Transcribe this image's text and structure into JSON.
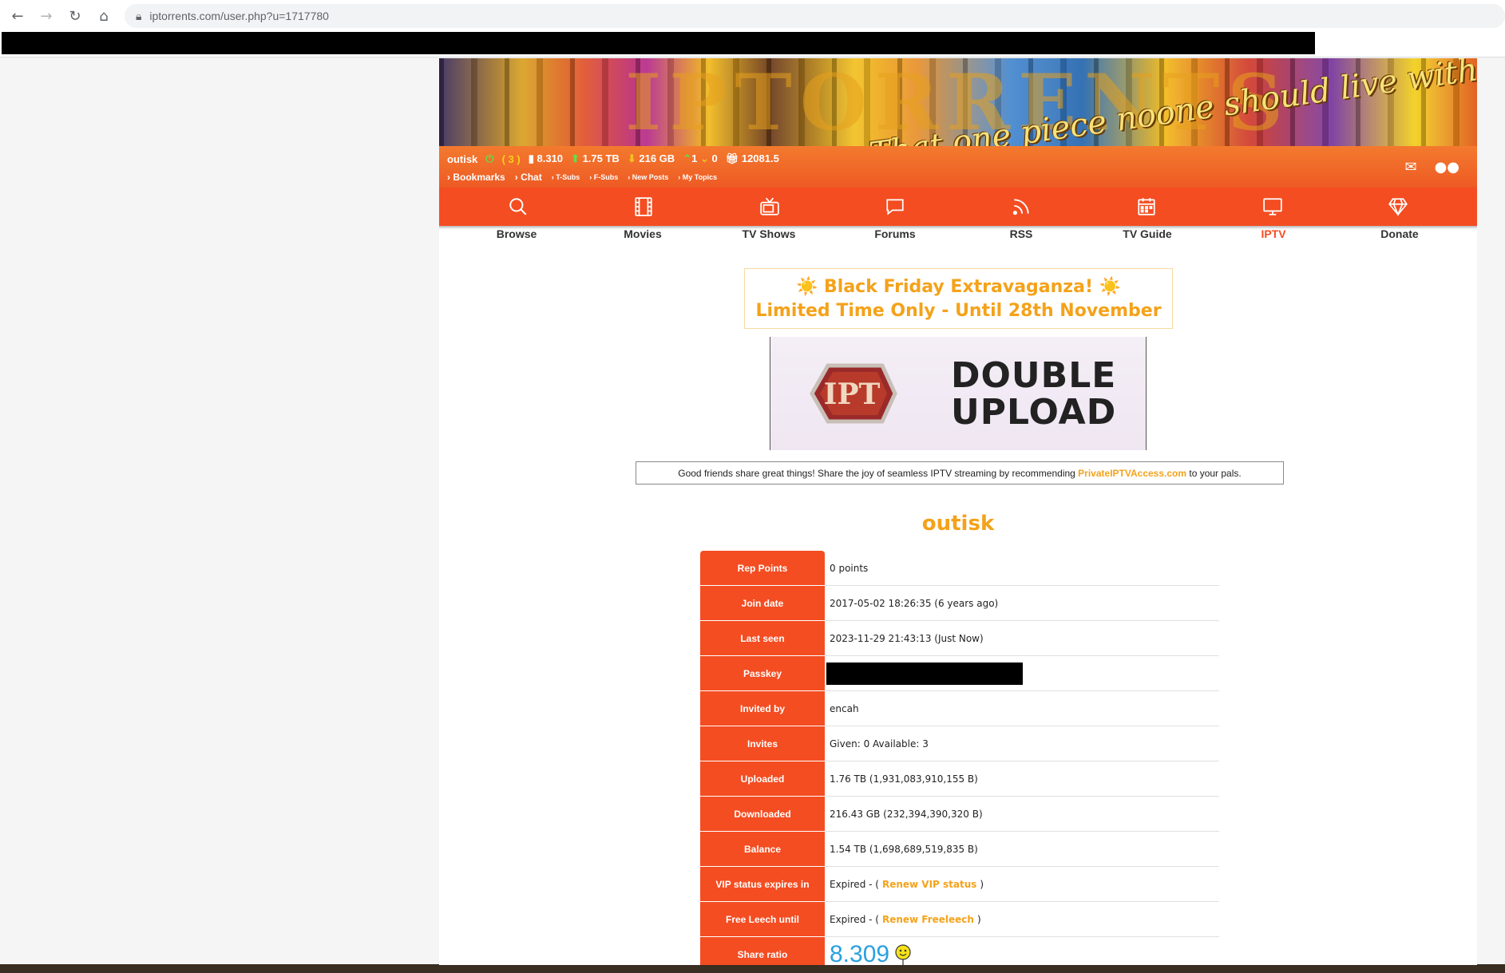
{
  "browser": {
    "url": "iptorrents.com/user.php?u=1717780"
  },
  "banner": {
    "slogan": "That one piece noone should live without",
    "letters": "IPTORRENTS"
  },
  "status": {
    "username": "outisk",
    "power_badge": "( 3 )",
    "ratio": "8.310",
    "uploaded": "1.75 TB",
    "downloaded": "216 GB",
    "seeding": "1",
    "leeching": "0",
    "bonus": "12081.5",
    "links": [
      "Bookmarks",
      "Chat",
      "T-Subs",
      "F-Subs",
      "New Posts",
      "My Topics"
    ]
  },
  "nav": [
    {
      "label": "Browse",
      "icon": "search-icon"
    },
    {
      "label": "Movies",
      "icon": "film-icon"
    },
    {
      "label": "TV Shows",
      "icon": "tv-icon"
    },
    {
      "label": "Forums",
      "icon": "chat-icon"
    },
    {
      "label": "RSS",
      "icon": "rss-icon"
    },
    {
      "label": "TV Guide",
      "icon": "calendar-icon"
    },
    {
      "label": "IPTV",
      "icon": "monitor-icon",
      "active": true
    },
    {
      "label": "Donate",
      "icon": "diamond-icon"
    }
  ],
  "promo": {
    "line1": "☀️ Black Friday Extravaganza! ☀️",
    "line2": "Limited Time Only - Until 28th November"
  },
  "double_upload": {
    "line1": "DOUBLE",
    "line2": "UPLOAD",
    "badge": "IPT"
  },
  "share": {
    "before": "Good friends share great things! Share the joy of seamless IPTV streaming by recommending ",
    "link": "PrivateIPTVAccess.com",
    "after": " to your pals."
  },
  "profile": {
    "username": "outisk",
    "rows": [
      {
        "label": "Rep Points",
        "value": "0 points"
      },
      {
        "label": "Join date",
        "value": "2017-05-02 18:26:35 (6 years ago)"
      },
      {
        "label": "Last seen",
        "value": "2023-11-29 21:43:13 (Just Now)"
      },
      {
        "label": "Passkey",
        "value": ""
      },
      {
        "label": "Invited by",
        "value": "encah"
      },
      {
        "label": "Invites",
        "value": "Given: 0 Available: 3"
      },
      {
        "label": "Uploaded",
        "value": "1.76 TB (1,931,083,910,155 B)"
      },
      {
        "label": "Downloaded",
        "value": "216.43 GB (232,394,390,320 B)"
      },
      {
        "label": "Balance",
        "value": "1.54 TB (1,698,689,519,835 B)"
      },
      {
        "label": "VIP status expires in",
        "value_prefix": "Expired - (",
        "link": "Renew VIP status",
        "value_suffix": ")"
      },
      {
        "label": "Free Leech until",
        "value_prefix": "Expired - (",
        "link": "Renew Freeleech",
        "value_suffix": ")"
      },
      {
        "label": "Share ratio",
        "value": "8.309"
      }
    ]
  },
  "colors": {
    "accent": "#f44d22",
    "gold": "#f4a21a",
    "ratio_blue": "#2aa0e0"
  }
}
